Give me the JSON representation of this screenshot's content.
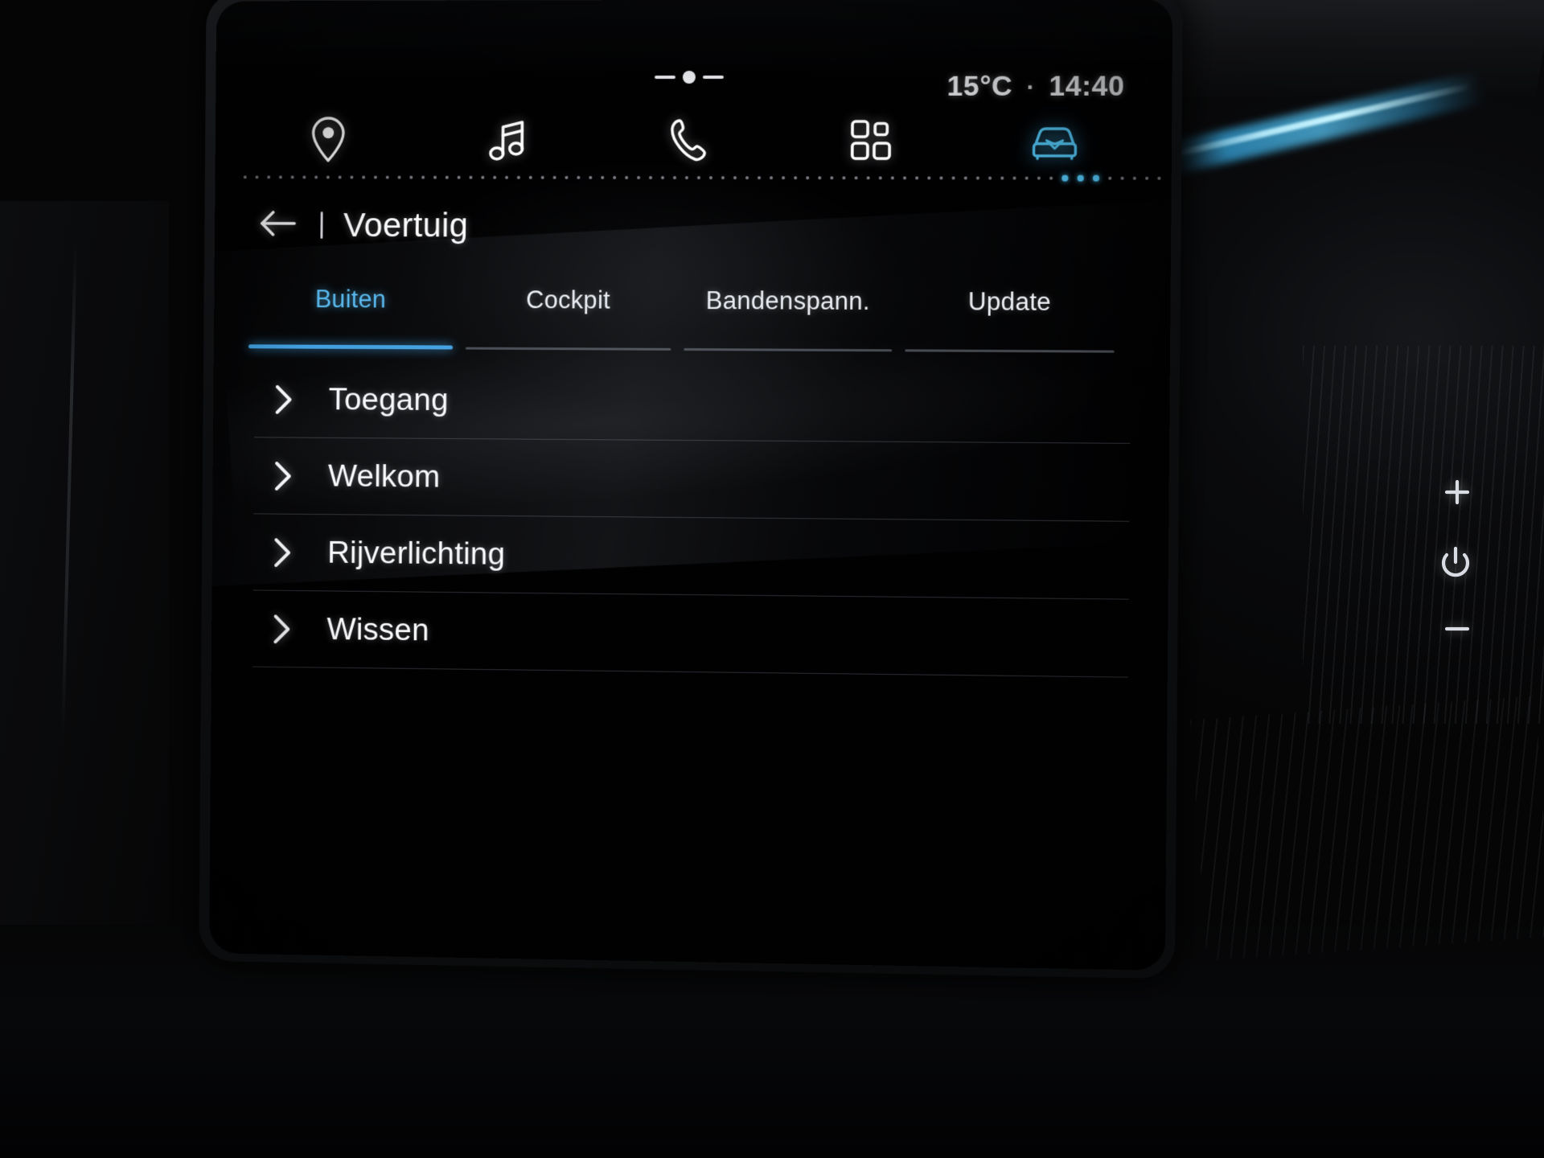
{
  "status_bar": {
    "temperature": "15°C",
    "separator": "·",
    "time": "14:40"
  },
  "nav_bar": {
    "items": [
      {
        "id": "navigation",
        "icon": "location-pin-icon",
        "active": false
      },
      {
        "id": "media",
        "icon": "music-note-icon",
        "active": false
      },
      {
        "id": "phone",
        "icon": "phone-handset-icon",
        "active": false
      },
      {
        "id": "apps",
        "icon": "apps-grid-icon",
        "active": false
      },
      {
        "id": "vehicle",
        "icon": "car-front-icon",
        "active": true
      }
    ],
    "active_accent": "#53c6f5"
  },
  "page_header": {
    "back_icon": "arrow-left-icon",
    "title": "Voertuig"
  },
  "tabs": [
    {
      "label": "Buiten",
      "active": true
    },
    {
      "label": "Cockpit",
      "active": false
    },
    {
      "label": "Bandenspann.",
      "active": false
    },
    {
      "label": "Update",
      "active": false
    }
  ],
  "list_items": [
    {
      "label": "Toegang",
      "chevron": "chevron-right-icon"
    },
    {
      "label": "Welkom",
      "chevron": "chevron-right-icon"
    },
    {
      "label": "Rijverlichting",
      "chevron": "chevron-right-icon"
    },
    {
      "label": "Wissen",
      "chevron": "chevron-right-icon"
    }
  ],
  "hardware_keys": [
    {
      "id": "volume-up",
      "icon": "plus-icon"
    },
    {
      "id": "power",
      "icon": "power-icon"
    },
    {
      "id": "volume-down",
      "icon": "minus-icon"
    }
  ],
  "theme": {
    "accent_blue": "#53c6f5",
    "tab_active_blue": "#56b9ef",
    "underline_blue": "#3f9fe0",
    "text_primary": "#fbfcfe",
    "screen_bg": "#010102"
  }
}
